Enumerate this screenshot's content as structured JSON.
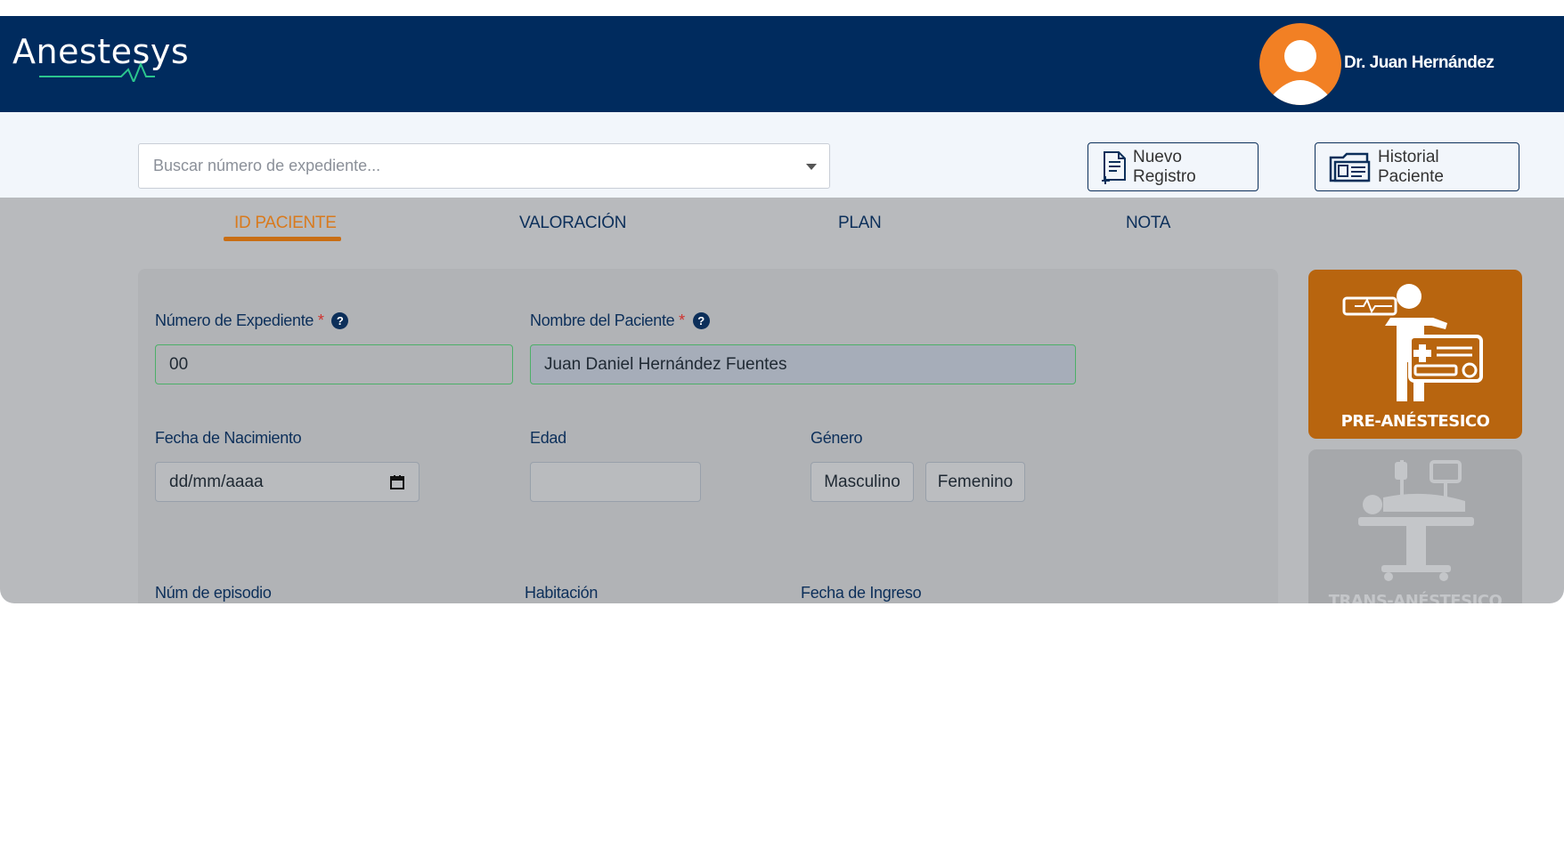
{
  "header": {
    "app_name": "Anestesys",
    "user_name": "Dr. Juan Hernández",
    "colors": {
      "bar": "#002b5e",
      "avatar": "#f28024",
      "wave": "#2bc58e"
    }
  },
  "toolbar": {
    "search_placeholder": "Buscar número de expediente...",
    "new_record_label": "Nuevo Registro",
    "history_label": "Historial Paciente",
    "icons": {
      "new_record": "document-add-icon",
      "history": "folder-id-card-icon"
    }
  },
  "tabs": [
    {
      "label": "ID PACIENTE",
      "active": true
    },
    {
      "label": "VALORACIÓN",
      "active": false
    },
    {
      "label": "PLAN",
      "active": false
    },
    {
      "label": "NOTA",
      "active": false
    }
  ],
  "form": {
    "expediente": {
      "label": "Número de Expediente",
      "required_mark": "*",
      "help": "?",
      "value": "00"
    },
    "nombre": {
      "label": "Nombre del Paciente",
      "required_mark": "*",
      "help": "?",
      "value": "Juan Daniel Hernández Fuentes"
    },
    "fecha_nacimiento": {
      "label": "Fecha de Nacimiento",
      "placeholder": "dd/mm/aaaa"
    },
    "edad": {
      "label": "Edad",
      "value": ""
    },
    "genero": {
      "label": "Género",
      "options": [
        "Masculino",
        "Femenino"
      ]
    },
    "episodio": {
      "label": "Núm de episodio"
    },
    "habitacion": {
      "label": "Habitación"
    },
    "fecha_ingreso": {
      "label": "Fecha de Ingreso"
    }
  },
  "stages": [
    {
      "label": "PRE-ANÉSTESICO",
      "active": true,
      "color": "#b8650f",
      "icon": "patient-monitor-icon"
    },
    {
      "label": "TRANS-ANÉSTESICO",
      "active": false,
      "color": "#a6a8ab",
      "icon": "operating-bed-icon"
    }
  ]
}
